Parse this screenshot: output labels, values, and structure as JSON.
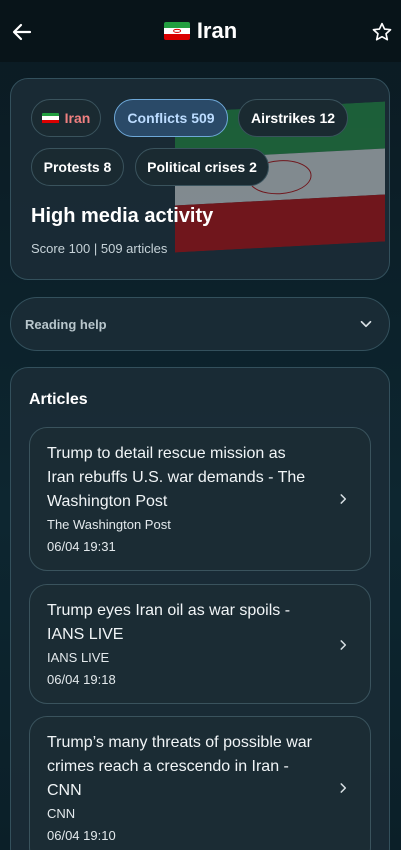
{
  "header": {
    "title": "Iran",
    "back_icon": "arrow-left-icon",
    "favorite_icon": "star-outline-icon"
  },
  "summary": {
    "chips": [
      {
        "label": "Iran",
        "icon": "iran-flag-icon"
      },
      {
        "label": "Conflicts 509"
      },
      {
        "label": "Airstrikes 12"
      },
      {
        "label": "Protests 8"
      },
      {
        "label": "Political crises 2"
      }
    ],
    "activity_title": "High media activity",
    "score_line": "Score 100 | 509 articles"
  },
  "reading_help": {
    "label": "Reading help",
    "icon": "chevron-down-icon"
  },
  "articles": {
    "title": "Articles",
    "items": [
      {
        "headline": "Trump to detail rescue mission as Iran rebuffs U.S. war demands - The Washington Post",
        "source": "The Washington Post",
        "date": "06/04 19:31"
      },
      {
        "headline": "Trump eyes Iran oil as war spoils - IANS LIVE",
        "source": "IANS LIVE",
        "date": "06/04 19:18"
      },
      {
        "headline": "Trump’s many threats of possible war crimes reach a crescendo in Iran - CNN",
        "source": "CNN",
        "date": "06/04 19:10"
      }
    ]
  },
  "colors": {
    "accent": "#6ea8d8",
    "background": "#0d2630",
    "card": "#1c2d37",
    "flag_green": "#239f40",
    "flag_red": "#da0000"
  }
}
